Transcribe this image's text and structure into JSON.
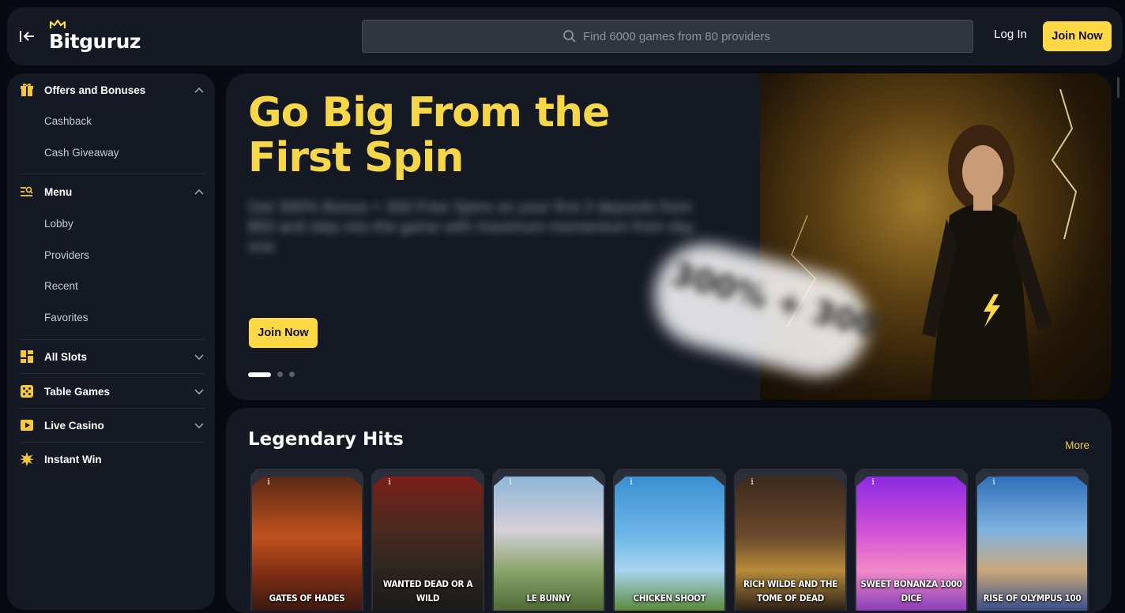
{
  "header": {
    "logo_text": "Bitguruz",
    "search_placeholder": "Find 6000 games from 80 providers",
    "login_label": "Log In",
    "join_label": "Join Now"
  },
  "sidebar": {
    "offers": {
      "label": "Offers and Bonuses",
      "icon": "gift-icon",
      "items": [
        "Cashback",
        "Cash Giveaway"
      ]
    },
    "menu": {
      "label": "Menu",
      "icon": "menu-icon",
      "items": [
        "Lobby",
        "Providers",
        "Recent",
        "Favorites"
      ]
    },
    "categories": [
      {
        "label": "All Slots",
        "icon": "grid-icon"
      },
      {
        "label": "Table Games",
        "icon": "dice-icon"
      },
      {
        "label": "Live Casino",
        "icon": "play-icon"
      },
      {
        "label": "Instant Win",
        "icon": "burst-icon"
      }
    ]
  },
  "hero": {
    "title": "Go Big From the First Spin",
    "description": "Get 300% Bonus + 300 Free Spins on your first 3 deposits from $50 and step into the game with maximum momentum from day one.",
    "badge": "300% + 300",
    "join_label": "Join Now",
    "slide_count": 3,
    "active_slide": 1
  },
  "hits": {
    "title": "Legendary Hits",
    "more_label": "More",
    "info_label": "i",
    "games": [
      {
        "name": "GATES OF HADES"
      },
      {
        "name": "WANTED DEAD OR A WILD"
      },
      {
        "name": "LE BUNNY"
      },
      {
        "name": "CHICKEN SHOOT"
      },
      {
        "name": "RICH WILDE AND THE TOME OF DEAD"
      },
      {
        "name": "SWEET BONANZA 1000 DICE"
      },
      {
        "name": "RISE OF OLYMPUS 100"
      }
    ]
  },
  "colors": {
    "accent": "#ffd945",
    "hero_title": "#f7d74a",
    "panel": "#141924",
    "page_bg": "#070a11"
  }
}
